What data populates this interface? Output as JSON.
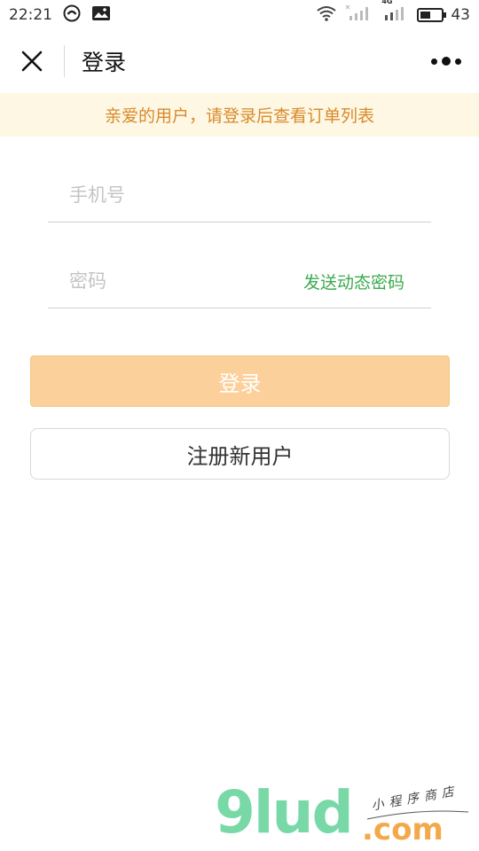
{
  "status_bar": {
    "time": "22:21",
    "battery": "43",
    "net": "4G"
  },
  "nav": {
    "title": "登录"
  },
  "notice": {
    "text": "亲爱的用户，请登录后查看订单列表"
  },
  "form": {
    "phone_placeholder": "手机号",
    "password_placeholder": "密码",
    "send_code_label": "发送动态密码"
  },
  "buttons": {
    "login": "登录",
    "register": "注册新用户"
  },
  "watermark": {
    "brand": "9lud",
    "tld": ".com",
    "tagline": "小程序商店"
  },
  "colors": {
    "notice_bg": "#fdf7e3",
    "notice_text": "#d98a2b",
    "accent_green": "#3bab4f",
    "login_button": "#fcd09b",
    "watermark_green": "#78d9a7",
    "watermark_orange": "#f3a94a"
  }
}
